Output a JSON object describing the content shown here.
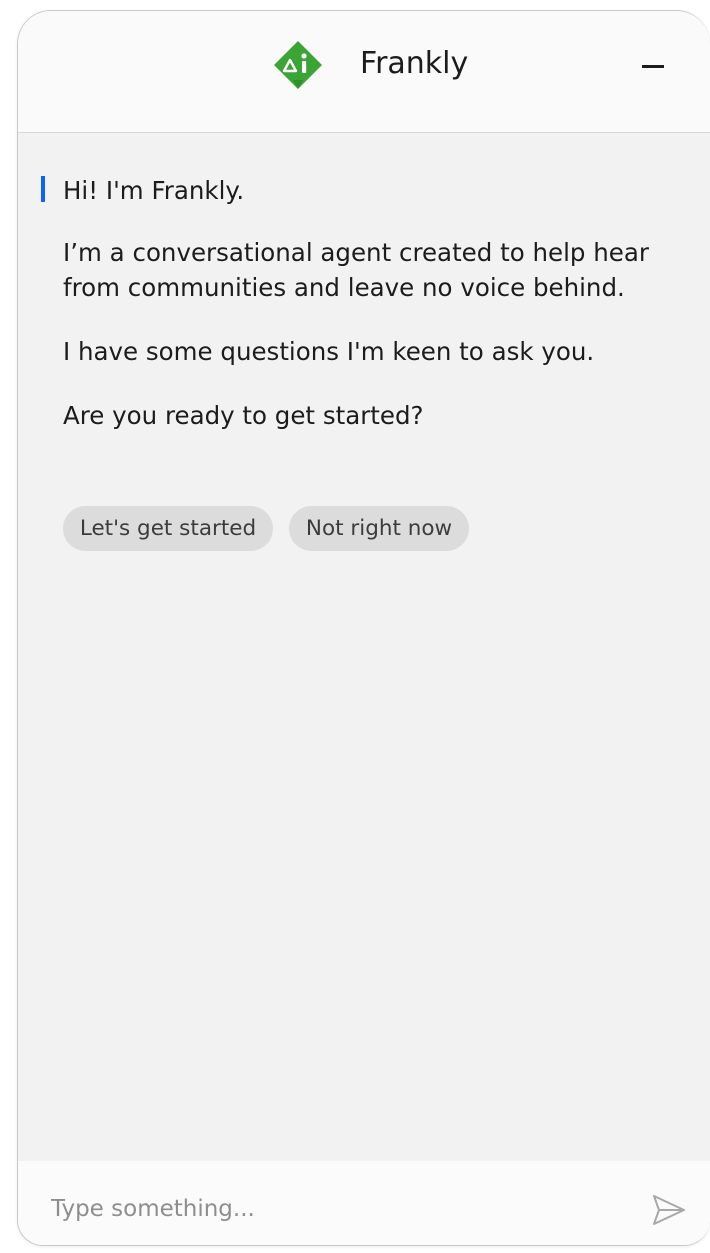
{
  "header": {
    "logo_icon": "frankly-ai-logo-icon",
    "title": "Frankly",
    "minimize_icon": "minimize-icon"
  },
  "messages": [
    "Hi! I'm Frankly.",
    "I’m a conversational agent created to help hear from communities and leave no voice behind.",
    "I have some questions I'm keen to ask you.",
    "Are you ready to get started?"
  ],
  "quick_replies": [
    "Let's get started",
    "Not right now"
  ],
  "composer": {
    "placeholder": "Type something...",
    "value": "",
    "send_icon": "send-icon"
  },
  "colors": {
    "brand_green": "#3aa535",
    "accent_blue": "#0f62fe",
    "chip_bg": "#dcdcdc"
  }
}
